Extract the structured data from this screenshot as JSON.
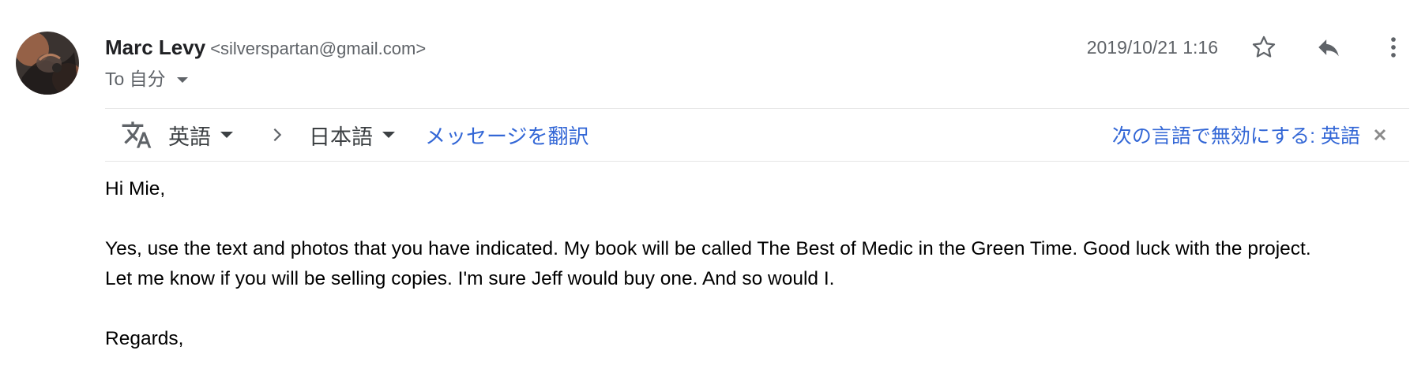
{
  "sender": {
    "name": "Marc Levy",
    "email": "<silverspartan@gmail.com>"
  },
  "recipient": {
    "to_label": "To 自分"
  },
  "timestamp": "2019/10/21 1:16",
  "icons": {
    "avatar": "avatar",
    "star": "star-icon",
    "reply": "reply-icon",
    "more": "more-vert-icon",
    "translate": "translate-icon",
    "arrow": "chevron-right-icon",
    "close": "close-icon"
  },
  "translate_bar": {
    "source_language": "英語",
    "target_language": "日本語",
    "translate_link": "メッセージを翻訳",
    "disable_link": "次の言語で無効にする: 英語"
  },
  "message": {
    "greeting": "Hi Mie,",
    "line1": "Yes, use the text and photos that you have indicated. My book will be called The Best of Medic in the Green Time. Good luck with the project.",
    "line2": "Let me know if you will be selling copies. I'm sure Jeff would buy one. And so would I.",
    "regards": "Regards,"
  },
  "colors": {
    "link": "#3367d6",
    "secondary_text": "#5f6368",
    "icon": "#5f6368",
    "divider": "#e5e5e5"
  }
}
